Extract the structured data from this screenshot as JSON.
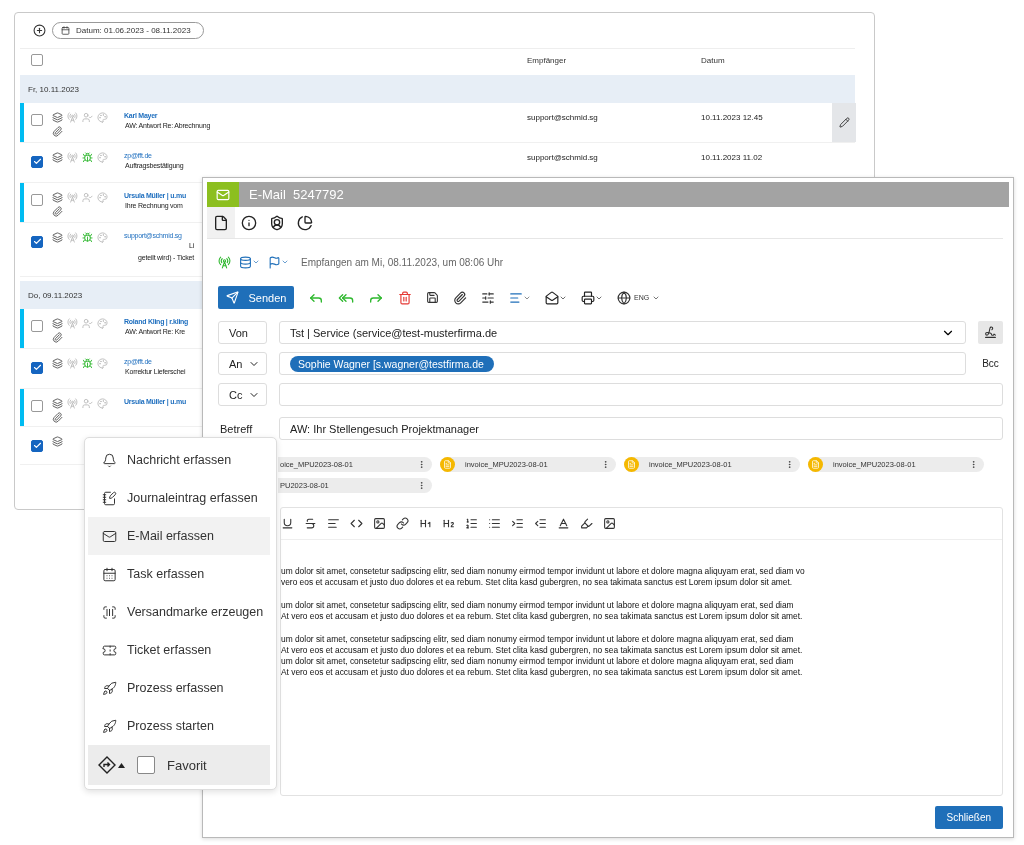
{
  "list_window": {
    "date_filter": "Datum: 01.06.2023 - 08.11.2023",
    "select_all": {
      "checked": false
    },
    "columns": [
      "Empfänger",
      "Datum"
    ],
    "groups": [
      {
        "label": "Fr, 10.11.2023",
        "rows": [
          {
            "checked": false,
            "flagged": true,
            "hovered": true,
            "name": "Karl Mayer",
            "subject_lines": [
              "AW: Antwort Re: Abrechnung"
            ],
            "recipient": "support@schmid.sg",
            "date": "10.11.2023 12.45",
            "icons": [
              {
                "kind": "tray",
                "active": false
              },
              {
                "kind": "antenna",
                "active": false
              },
              {
                "kind": "user-check",
                "active": false
              },
              {
                "kind": "palette",
                "active": false
              },
              {
                "kind": "paperclip",
                "active": false
              }
            ]
          },
          {
            "checked": true,
            "flagged": false,
            "hovered": false,
            "name": "zp@fft.de",
            "subject_lines": [
              "Auftragsbestätigung"
            ],
            "recipient": "support@schmid.sg",
            "date": "10.11.2023 11.02",
            "icons": [
              {
                "kind": "tray",
                "active": false
              },
              {
                "kind": "antenna",
                "active": false
              },
              {
                "kind": "bug",
                "active": true
              },
              {
                "kind": "palette",
                "active": false
              }
            ]
          },
          {
            "checked": false,
            "flagged": true,
            "hovered": false,
            "name": "Ursula Müller | u.mu",
            "subject_lines": [
              "Ihre Rechnung vom"
            ],
            "icons": [
              {
                "kind": "tray",
                "active": false
              },
              {
                "kind": "antenna",
                "active": false
              },
              {
                "kind": "user-check",
                "active": false
              },
              {
                "kind": "palette",
                "active": false
              },
              {
                "kind": "paperclip",
                "active": false
              }
            ]
          },
          {
            "checked": true,
            "flagged": false,
            "hovered": false,
            "name": "support@schmid.sg",
            "subject_lines": [
              "Li",
              "geteilt wird) - Ticket"
            ],
            "icons": [
              {
                "kind": "tray",
                "active": false
              },
              {
                "kind": "antenna",
                "active": false
              },
              {
                "kind": "bug",
                "active": true
              },
              {
                "kind": "palette",
                "active": false
              }
            ]
          }
        ]
      },
      {
        "label": "Do, 09.11.2023",
        "rows": [
          {
            "checked": false,
            "flagged": true,
            "hovered": false,
            "name": "Roland Kling | r.kling",
            "subject_lines": [
              "AW: Antwort Re: Kre"
            ],
            "icons": [
              {
                "kind": "tray",
                "active": false
              },
              {
                "kind": "antenna",
                "active": false
              },
              {
                "kind": "user-check",
                "active": false
              },
              {
                "kind": "palette",
                "active": false
              },
              {
                "kind": "paperclip",
                "active": false
              }
            ]
          },
          {
            "checked": true,
            "flagged": false,
            "hovered": false,
            "name": "zp@fft.de",
            "subject_lines": [
              "Korrektur Lieferschei"
            ],
            "icons": [
              {
                "kind": "tray",
                "active": false
              },
              {
                "kind": "antenna",
                "active": false
              },
              {
                "kind": "bug",
                "active": true
              },
              {
                "kind": "palette",
                "active": false
              }
            ]
          },
          {
            "checked": false,
            "flagged": true,
            "hovered": false,
            "name": "Ursula Müller | u.mu",
            "icons": [
              {
                "kind": "tray",
                "active": false
              },
              {
                "kind": "antenna",
                "active": false
              },
              {
                "kind": "user-check",
                "active": false
              },
              {
                "kind": "palette",
                "active": false
              },
              {
                "kind": "paperclip",
                "active": false
              }
            ]
          },
          {
            "checked": true,
            "flagged": false,
            "hovered": false,
            "icons": [
              {
                "kind": "tray",
                "active": false
              }
            ]
          }
        ]
      }
    ]
  },
  "email_dialog": {
    "title": "E-Mail",
    "number": "5247792",
    "tabs": [
      {
        "kind": "document",
        "selected": true
      },
      {
        "kind": "info",
        "selected": false
      },
      {
        "kind": "user",
        "selected": false
      },
      {
        "kind": "chart",
        "selected": false
      }
    ],
    "status_text": "Empfangen am Mi, 08.11.2023, um 08:06 Uhr",
    "send_label": "Senden",
    "language": "ENG",
    "from_label": "Von",
    "from_value": "Tst | Service (service@test-musterfirma.de",
    "to_label": "An",
    "recipients": [
      "Sophie Wagner [s.wagner@testfirma.de"
    ],
    "bcc_label": "Bcc",
    "cc_label": "Cc",
    "subject_label": "Betreff",
    "subject_value": "AW: Ihr Stellengesuch Projektmanager",
    "attachments": [
      {
        "name": "oice_MPU2023-08-01",
        "cut": true
      },
      {
        "name": "invoice_MPU2023-08-01",
        "cut": false
      },
      {
        "name": "invoice_MPU2023-08-01",
        "cut": false
      },
      {
        "name": "invoice_MPU2023-08-01",
        "cut": false
      },
      {
        "name": "PU2023-08-01",
        "cut": true
      }
    ],
    "body": [
      [
        "um dolor sit amet, consetetur sadipscing elitr, sed diam nonumy eirmod tempor invidunt ut labore et dolore magna aliquyam erat, sed diam vo",
        "vero eos et accusam et justo duo dolores et ea rebum. Stet clita kasd gubergren, no sea takimata sanctus est Lorem ipsum dolor sit amet."
      ],
      [
        "um dolor sit amet, consetetur sadipscing elitr, sed diam nonumy eirmod tempor invidunt ut labore et dolore magna aliquyam erat, sed diam",
        "At vero eos et accusam et justo duo dolores et ea rebum. Stet clita kasd gubergren, no sea takimata sanctus est Lorem ipsum dolor sit amet."
      ],
      [
        "um dolor sit amet, consetetur sadipscing elitr, sed diam nonumy eirmod tempor invidunt ut labore et dolore magna aliquyam erat, sed diam",
        "At vero eos et accusam et justo duo dolores et ea rebum. Stet clita kasd gubergren, no sea takimata sanctus est Lorem ipsum dolor sit amet.",
        "um dolor sit amet, consetetur sadipscing elitr, sed diam nonumy eirmod tempor invidunt ut labore et dolore magna aliquyam erat, sed diam",
        "At vero eos et accusam et justo duo dolores et ea rebum. Stet clita kasd gubergren, no sea takimata sanctus est Lorem ipsum dolor sit amet."
      ]
    ],
    "close_label": "Schließen"
  },
  "menu": {
    "items": [
      {
        "kind": "bell",
        "label": "Nachricht erfassen",
        "selected": false
      },
      {
        "kind": "journal",
        "label": "Journaleintrag erfassen",
        "selected": false
      },
      {
        "kind": "mail",
        "label": "E-Mail erfassen",
        "selected": true
      },
      {
        "kind": "calendar",
        "label": "Task erfassen",
        "selected": false
      },
      {
        "kind": "barcode",
        "label": "Versandmarke erzeugen",
        "selected": false
      },
      {
        "kind": "ticket",
        "label": "Ticket erfassen",
        "selected": false
      },
      {
        "kind": "rocket",
        "label": "Prozess erfassen",
        "selected": false
      },
      {
        "kind": "rockets",
        "label": "Prozess starten",
        "selected": false
      }
    ],
    "favorite": {
      "label": "Favorit",
      "checked": false
    }
  }
}
